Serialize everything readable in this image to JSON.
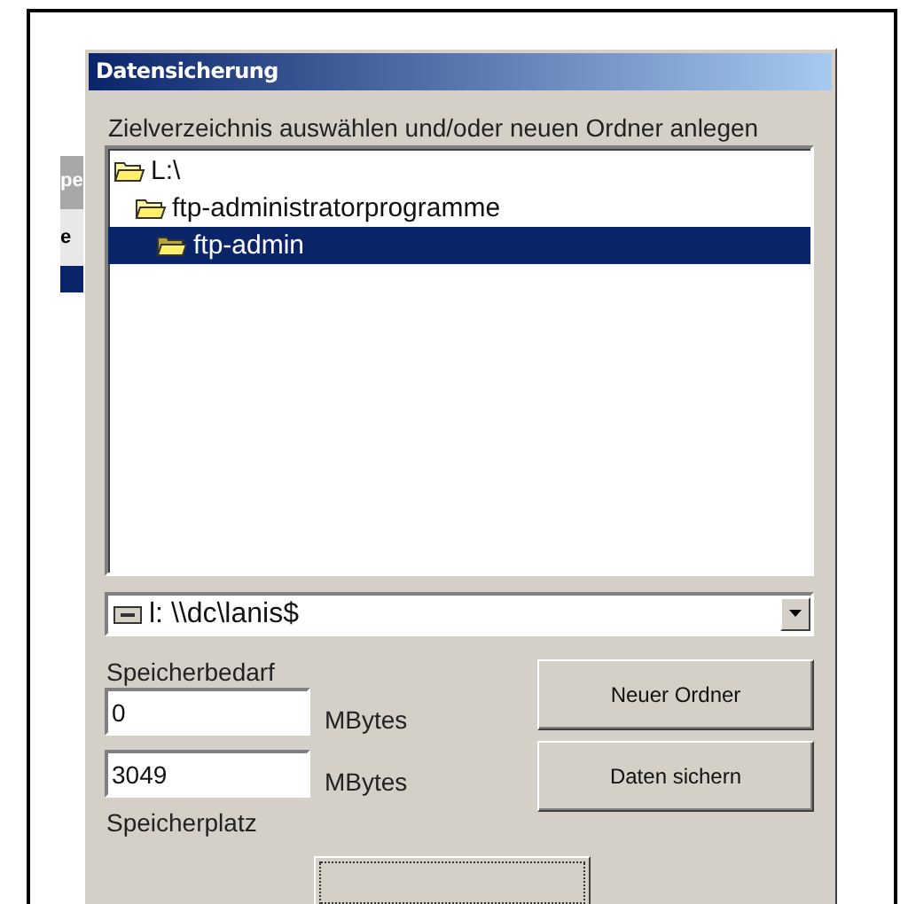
{
  "background_window": {
    "fragments": [
      "pe",
      "e"
    ]
  },
  "dialog": {
    "title": "Datensicherung",
    "instruction": "Zielverzeichnis auswählen und/oder neuen Ordner anlegen",
    "folders": [
      {
        "label": "L:\\",
        "selected": false,
        "children": [
          {
            "label": "ftp-administratorprogramme",
            "selected": false,
            "children": [
              {
                "label": "ftp-admin",
                "selected": true
              }
            ]
          }
        ]
      }
    ],
    "drive": {
      "value": "l: \\\\dc\\lanis$"
    },
    "required_label": "Speicherbedarf",
    "required_value": "0",
    "required_unit": "MBytes",
    "available_value": "3049",
    "available_unit": "MBytes",
    "available_label": "Speicherplatz",
    "buttons": [
      "Neuer Ordner",
      "Daten sichern"
    ]
  }
}
